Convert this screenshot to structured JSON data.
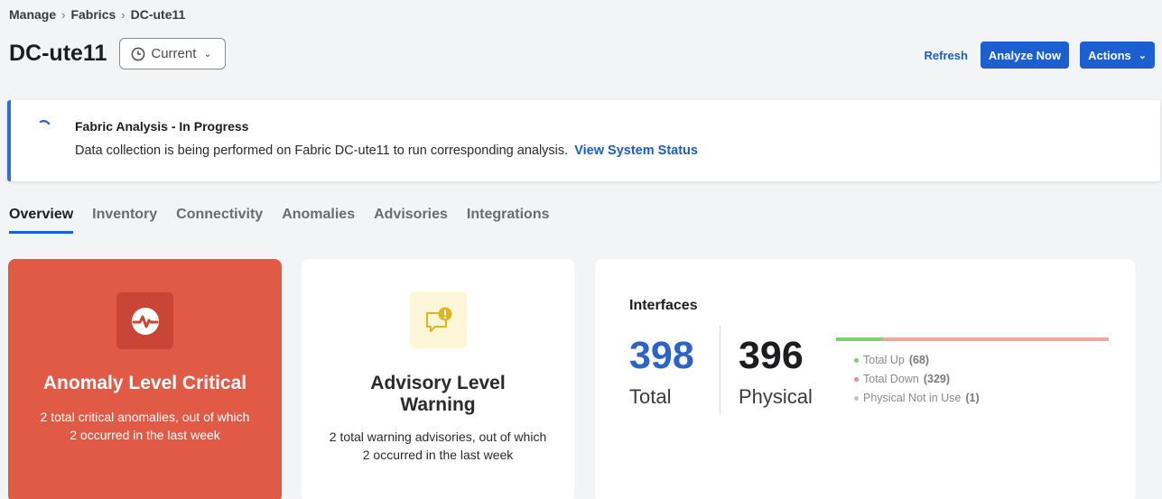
{
  "breadcrumb": {
    "items": [
      "Manage",
      "Fabrics",
      "DC-ute11"
    ],
    "separator": "›"
  },
  "header": {
    "title": "DC-ute11",
    "time_select": {
      "value": "Current",
      "icon": "clock-icon"
    },
    "refresh_label": "Refresh",
    "analyze_label": "Analyze Now",
    "actions_label": "Actions"
  },
  "alert": {
    "title": "Fabric Analysis - In Progress",
    "body": "Data collection is being performed on Fabric DC-ute11 to run corresponding analysis.",
    "link": "View System Status",
    "icon": "spinner-icon"
  },
  "tabs": [
    "Overview",
    "Inventory",
    "Connectivity",
    "Anomalies",
    "Advisories",
    "Integrations"
  ],
  "active_tab": "Overview",
  "anomaly_card": {
    "title": "Anomaly Level Critical",
    "description": "2 total critical anomalies, out of which 2 occurred in the last week",
    "icon": "anomaly-pulse-icon",
    "color": "#e05a45"
  },
  "advisory_card": {
    "title": "Advisory Level Warning",
    "description": "2 total warning advisories, out of which 2 occurred in the last week",
    "icon": "advisory-warning-icon",
    "color": "#f2c12e"
  },
  "interfaces": {
    "heading": "Interfaces",
    "total": {
      "value": "398",
      "label": "Total"
    },
    "physical": {
      "value": "396",
      "label": "Physical"
    },
    "legend": [
      {
        "label": "Total Up",
        "count": "(68)",
        "color": "#7ecf6e"
      },
      {
        "label": "Total Down",
        "count": "(329)",
        "color": "#ef8a7c"
      },
      {
        "label": "Physical Not in Use",
        "count": "(1)",
        "color": "#c4c4c4"
      }
    ],
    "bar": {
      "up": 68,
      "down": 329
    }
  },
  "colors": {
    "accent": "#1c5fd0",
    "link": "#1a5fc4",
    "total_value": "#2b64c8"
  }
}
